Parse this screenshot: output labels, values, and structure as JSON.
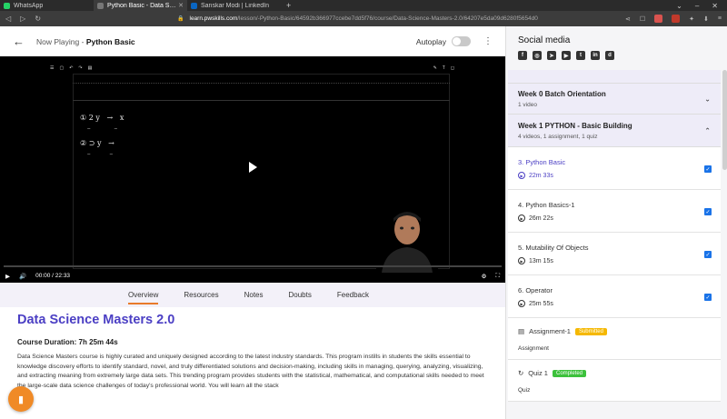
{
  "browser": {
    "tabs": [
      {
        "title": "WhatsApp",
        "color": "#25d366",
        "active": false
      },
      {
        "title": "Python Basic - Data Scienc",
        "color": "#555555",
        "active": true
      },
      {
        "title": "Sanskar Modi | LinkedIn",
        "color": "#0a66c2",
        "active": false
      }
    ],
    "url_host": "learn.pwskills.com",
    "url_path": "/lesson/-Python-Basic/64592b366977ccebe7dd5f76/course/Data-Science-Masters-2.0/64207e5da09d6280f5654d0"
  },
  "header": {
    "now_playing_prefix": "Now Playing - ",
    "now_playing_title": "Python Basic",
    "autoplay_label": "Autoplay"
  },
  "video": {
    "time": "00:00 / 22:33",
    "scribble": "① 2 y   →   x\n   ⁻          ⁻\n② ⊃ y   →\n   ⁻        ⁻"
  },
  "tabs": [
    "Overview",
    "Resources",
    "Notes",
    "Doubts",
    "Feedback"
  ],
  "course": {
    "title": "Data Science Masters 2.0",
    "duration": "Course Duration: 7h 25m 44s",
    "description": "Data Science Masters course is highly curated and uniquely designed according to the latest industry standards. This program instills in students the skills essential to knowledge discovery efforts to identify standard, novel, and truly differentiated solutions and decision-making, including skills in managing, querying, analyzing, visualizing, and extracting meaning from extremely large data sets. This trending program provides students with the statistical, mathematical, and computational skills needed to meet the large-scale data science challenges of today's professional world. You will learn all the stack"
  },
  "sidebar": {
    "social_title": "Social media",
    "sections": [
      {
        "title": "Week 0 Batch Orientation",
        "subtitle": "1 video"
      },
      {
        "title": "Week 1 PYTHON - Basic Building",
        "subtitle": "4 videos, 1 assignment, 1 quiz"
      }
    ],
    "lessons": [
      {
        "title": "3. Python Basic",
        "duration": "22m 33s"
      },
      {
        "title": "4. Python Basics-1",
        "duration": "26m 22s"
      },
      {
        "title": "5. Mutability Of Objects",
        "duration": "13m 15s"
      },
      {
        "title": "6. Operator",
        "duration": "25m 55s"
      }
    ],
    "assignment": {
      "title": "Assignment-1",
      "badge": "Submitted",
      "badge_color": "#f5b800",
      "sub": "Assignment"
    },
    "quiz": {
      "title": "Quiz 1",
      "badge": "Completed",
      "badge_color": "#3cc13b",
      "sub": "Quiz"
    }
  },
  "colors": {
    "accent": "#4b3fc4",
    "tab_underline": "#e87a2a",
    "chat": "#f08a26"
  }
}
